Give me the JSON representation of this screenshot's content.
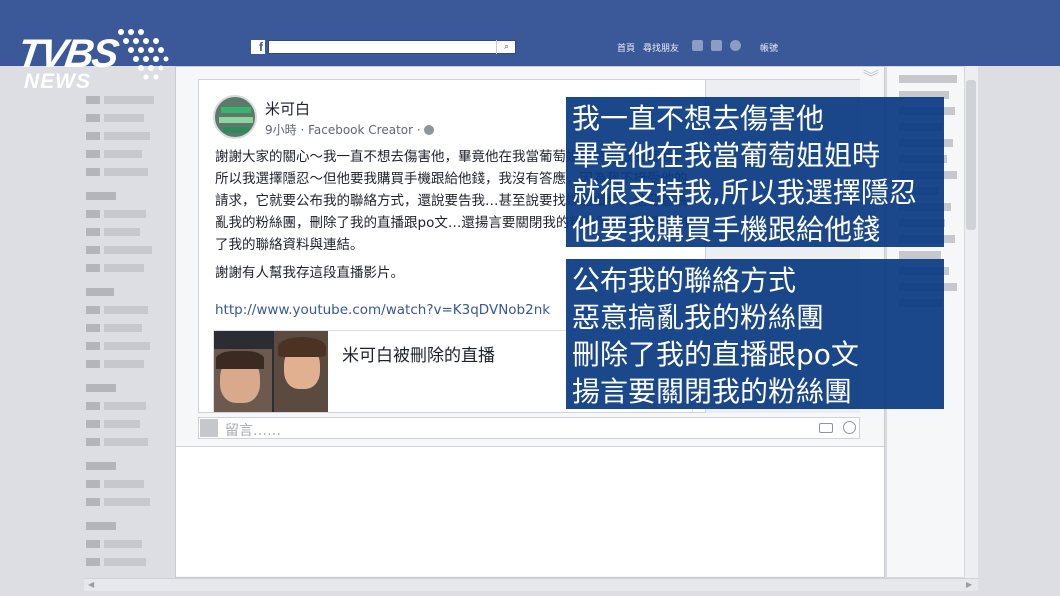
{
  "logo": {
    "brand": "TVBS",
    "sub": "NEWS"
  },
  "topbar": {
    "fb_glyph": "f",
    "search_icon": "⌕",
    "nav_home": "首頁",
    "nav_find_friends": "尋找朋友",
    "nav_account": "帳號"
  },
  "post": {
    "author": "米可白",
    "meta": "9小時 · Facebook Creator ·",
    "body_p1": "謝謝大家的關心～我一直不想去傷害他，畢竟他在我當葡萄姐姐時就很支持我，所以我選擇隱忍～但他要我購買手機跟給他錢，我沒有答應，因為我不接受他的請求，它就要公布我的聯絡方式，還說要告我…甚至說要找媒體爆料。他惡意搞亂我的粉絲團，刪除了我的直播跟po文…還揚言要關閉我的粉絲團…甚至還刪除了我的聯絡資料與連結。",
    "body_p2": "謝謝有人幫我存這段直播影片。",
    "link": "http://www.youtube.com/watch?v=K3qDVNob2nk",
    "preview_title": "米可白被刪除的直播"
  },
  "comment": {
    "placeholder": "留言……"
  },
  "captions": {
    "box1": [
      "我一直不想去傷害他",
      "畢竟他在我當葡萄姐姐時",
      "就很支持我,所以我選擇隱忍",
      "他要我購買手機跟給他錢"
    ],
    "box2": [
      "公布我的聯絡方式",
      "惡意搞亂我的粉絲團",
      "刪除了我的直播跟po文",
      "揚言要關閉我的粉絲團"
    ]
  },
  "colors": {
    "facebook_blue": "#3b5998",
    "caption_bg": "#0a3a82",
    "link": "#365899"
  }
}
